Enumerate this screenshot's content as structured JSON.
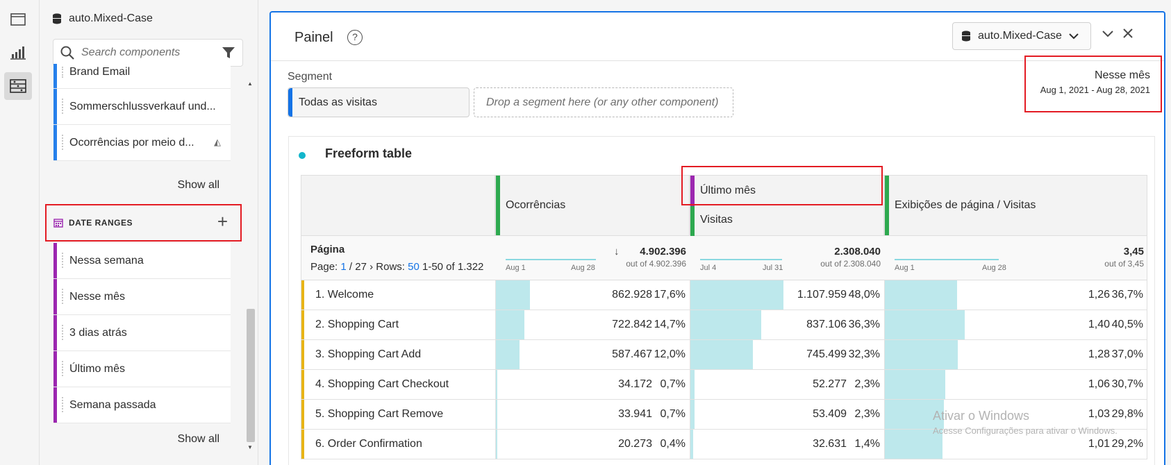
{
  "sidebar": {
    "datasource": "auto.Mixed-Case",
    "search_placeholder": "Search components",
    "components": [
      {
        "label": "Brand Email",
        "color": "#2680eb"
      },
      {
        "label": "Sommerschlussverkauf und...",
        "color": "#2680eb"
      },
      {
        "label": "Ocorrências por meio d...",
        "color": "#2680eb"
      }
    ],
    "show_all_1": "Show all",
    "date_ranges_header": "DATE RANGES",
    "date_ranges": [
      {
        "label": "Nessa semana"
      },
      {
        "label": "Nesse mês"
      },
      {
        "label": "3 dias atrás"
      },
      {
        "label": "Último mês"
      },
      {
        "label": "Semana passada"
      }
    ],
    "show_all_2": "Show all",
    "date_color": "#9c27b0"
  },
  "header": {
    "title": "Painel",
    "help": "?",
    "datasource": "auto.Mixed-Case"
  },
  "segment": {
    "label": "Segment",
    "applied": "Todas as visitas",
    "drop_hint": "Drop a segment here (or any other component)"
  },
  "date_range": {
    "name": "Nesse mês",
    "range": "Aug 1, 2021 - Aug 28, 2021"
  },
  "table": {
    "title": "Freeform table",
    "dimension": "Página",
    "pager": {
      "page_label": "Page:",
      "page": "1",
      "of": "/ 27",
      "rows_label": "Rows:",
      "rows": "50",
      "range": "1-50 of 1.322"
    },
    "columns": [
      {
        "name": "Ocorrências",
        "total": "4.902.396",
        "out_of": "out of 4.902.396",
        "spark_start": "Aug 1",
        "spark_end": "Aug 28"
      },
      {
        "name": "Último mês",
        "sub": "Visitas",
        "total": "2.308.040",
        "out_of": "out of 2.308.040",
        "spark_start": "Jul 4",
        "spark_end": "Jul 31"
      },
      {
        "name": "Exibições de página / Visitas",
        "total": "3,45",
        "out_of": "out of 3,45",
        "spark_start": "Aug 1",
        "spark_end": "Aug 28"
      }
    ],
    "rows": [
      {
        "label": "1. Welcome",
        "c1": "862.928",
        "p1": "17,6%",
        "f1": 0.176,
        "c2": "1.107.959",
        "p2": "48,0%",
        "f2": 0.48,
        "c3": "1,26",
        "p3": "36,7%",
        "f3": 0.367
      },
      {
        "label": "2. Shopping Cart",
        "c1": "722.842",
        "p1": "14,7%",
        "f1": 0.147,
        "c2": "837.106",
        "p2": "36,3%",
        "f2": 0.363,
        "c3": "1,40",
        "p3": "40,5%",
        "f3": 0.405
      },
      {
        "label": "3. Shopping Cart Add",
        "c1": "587.467",
        "p1": "12,0%",
        "f1": 0.12,
        "c2": "745.499",
        "p2": "32,3%",
        "f2": 0.323,
        "c3": "1,28",
        "p3": "37,0%",
        "f3": 0.37
      },
      {
        "label": "4. Shopping Cart Checkout",
        "c1": "34.172",
        "p1": "0,7%",
        "f1": 0.007,
        "c2": "52.277",
        "p2": "2,3%",
        "f2": 0.023,
        "c3": "1,06",
        "p3": "30,7%",
        "f3": 0.307
      },
      {
        "label": "5. Shopping Cart Remove",
        "c1": "33.941",
        "p1": "0,7%",
        "f1": 0.007,
        "c2": "53.409",
        "p2": "2,3%",
        "f2": 0.023,
        "c3": "1,03",
        "p3": "29,8%",
        "f3": 0.298
      },
      {
        "label": "6. Order Confirmation",
        "c1": "20.273",
        "p1": "0,4%",
        "f1": 0.004,
        "c2": "32.631",
        "p2": "1,4%",
        "f2": 0.014,
        "c3": "1,01",
        "p3": "29,2%",
        "f3": 0.292
      }
    ]
  },
  "watermark": {
    "line1": "Ativar o Windows",
    "line2": "Acesse Configurações para ativar o Windows."
  }
}
